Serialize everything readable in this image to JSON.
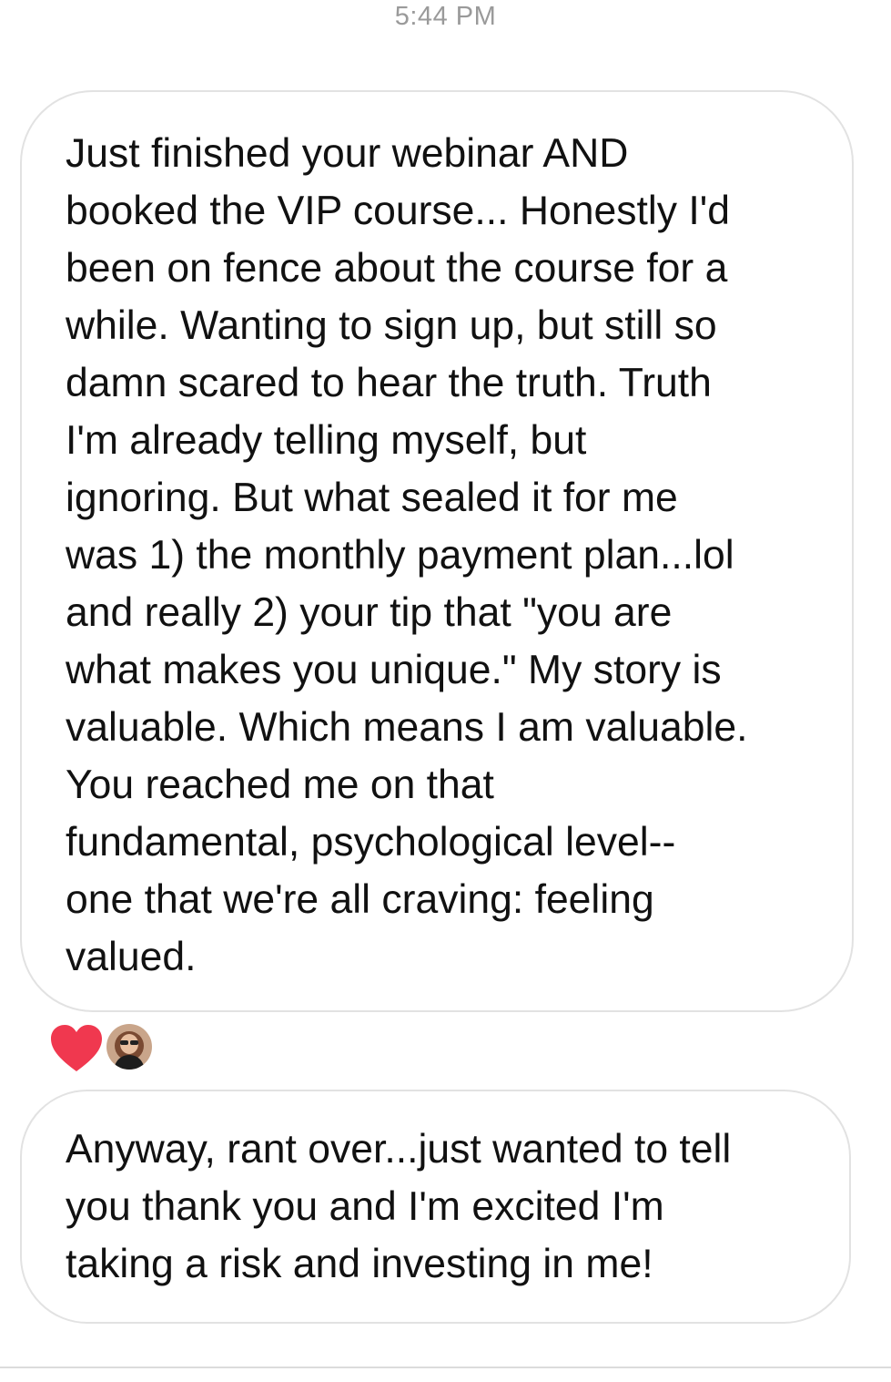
{
  "thread": {
    "timestamp": "5:44 PM",
    "messages": [
      {
        "text": "Just finished your webinar AND\nbooked the VIP course... Honestly I'd\nbeen on fence about the course for a\nwhile. Wanting to sign up, but still so\ndamn scared to hear the truth. Truth\nI'm already telling myself, but\nignoring. But what sealed it for me\nwas 1) the monthly payment plan...lol\nand really 2) your tip that \"you are\nwhat makes you unique.\" My story is\nvaluable. Which means I am valuable.\nYou reached me on that\nfundamental, psychological level--\none that we're all craving: feeling\nvalued.",
        "reaction": "heart-icon"
      },
      {
        "text": "Anyway, rant over...just wanted to tell\nyou thank you and I'm excited I'm\ntaking a risk and investing in me!"
      }
    ]
  },
  "colors": {
    "heart": "#f0384f",
    "bubble_border": "#e2e2e2",
    "timestamp": "#9a9a9a"
  }
}
